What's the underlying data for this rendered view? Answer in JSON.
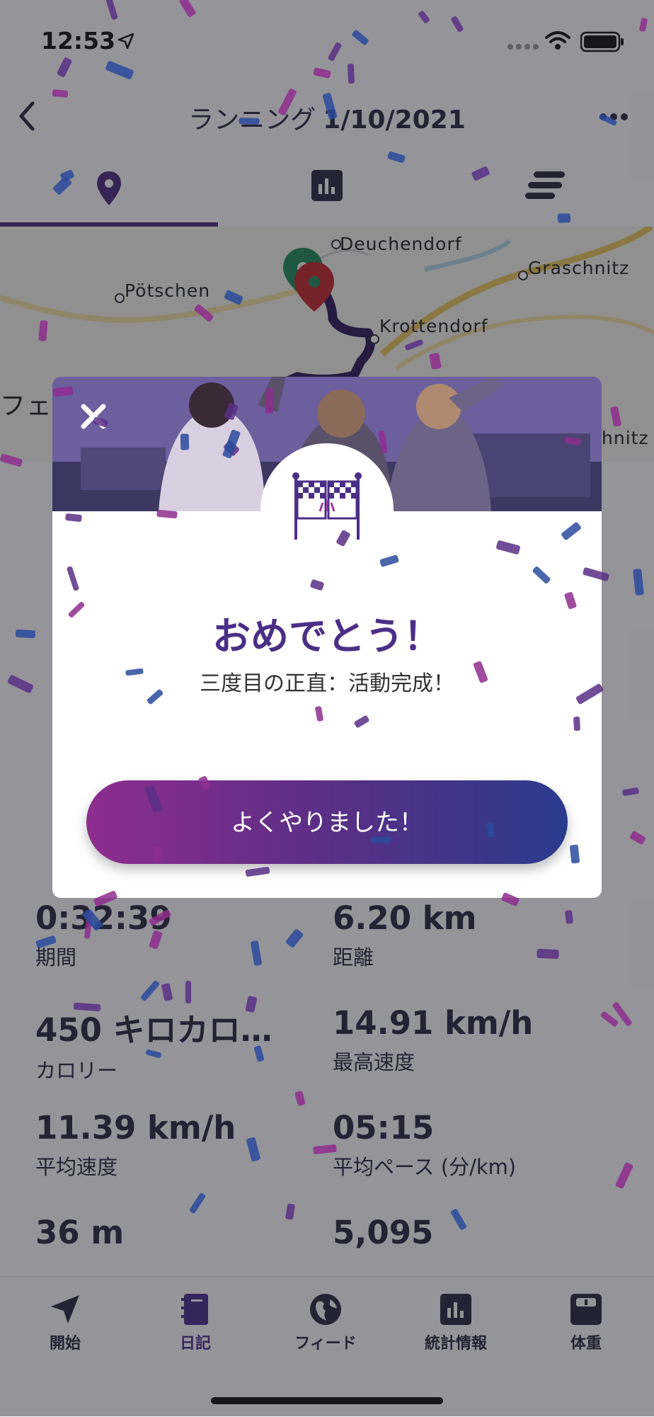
{
  "status_bar": {
    "time": "12:53"
  },
  "header": {
    "activity_type": "ランニング",
    "date": "1/10/2021"
  },
  "tabs": [
    {
      "id": "map",
      "icon": "map-pin-icon",
      "active": true
    },
    {
      "id": "charts",
      "icon": "bar-chart-icon",
      "active": false
    },
    {
      "id": "laps",
      "icon": "list-icon",
      "active": false
    }
  ],
  "map": {
    "labels": [
      "Deuchendorf",
      "Pötschen",
      "Graschnitz",
      "Krottendorf",
      "フェ",
      "hnitz"
    ]
  },
  "stats": [
    {
      "value": "0:32:39",
      "label": "期間"
    },
    {
      "value": "6.20 km",
      "label": "距離"
    },
    {
      "value": "450 キロカロ…",
      "label": "カロリー"
    },
    {
      "value": "14.91 km/h",
      "label": "最高速度"
    },
    {
      "value": "11.39 km/h",
      "label": "平均速度"
    },
    {
      "value": "05:15",
      "label": "平均ペース (分/km)"
    },
    {
      "value": "36 m",
      "label": ""
    },
    {
      "value": "5,095",
      "label": ""
    }
  ],
  "modal": {
    "title": "おめでとう！",
    "subtitle": "三度目の正直：活動完成！",
    "button_label": "よくやりました！",
    "badge_icon": "checkered-flags-icon"
  },
  "bottom_nav": [
    {
      "label": "開始",
      "icon": "navigation-arrow-icon",
      "active": false
    },
    {
      "label": "日記",
      "icon": "diary-book-icon",
      "active": true
    },
    {
      "label": "フィード",
      "icon": "globe-icon",
      "active": false
    },
    {
      "label": "統計情報",
      "icon": "stats-chart-icon",
      "active": false
    },
    {
      "label": "体重",
      "icon": "scale-icon",
      "active": false
    }
  ],
  "colors": {
    "accent": "#4b2a8a",
    "button_gradient_start": "#8e2d8e",
    "button_gradient_end": "#2a3b8c",
    "confetti_purple": "#8e2d8e",
    "confetti_blue": "#2a4a9c",
    "confetti_violet": "#5a2f86"
  }
}
